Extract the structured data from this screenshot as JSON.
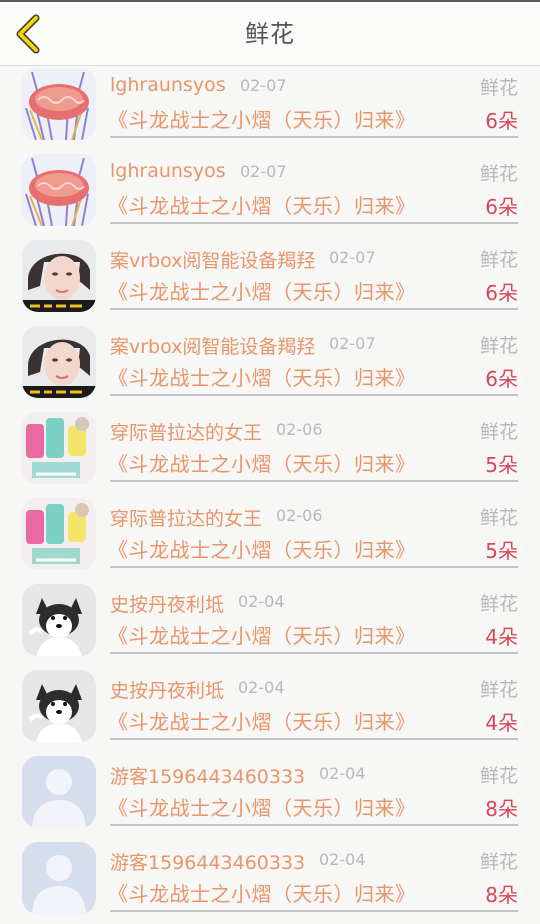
{
  "header": {
    "title": "鲜花"
  },
  "rows": [
    {
      "name": "lghraunsyos",
      "date": "02-07",
      "gift_type": "鲜花",
      "target": "《斗龙战士之小熠（天乐）归来》",
      "count": "6朵",
      "avatar": "cake"
    },
    {
      "name": "lghraunsyos",
      "date": "02-07",
      "gift_type": "鲜花",
      "target": "《斗龙战士之小熠（天乐）归来》",
      "count": "6朵",
      "avatar": "cake"
    },
    {
      "name": "案vrbox阅智能设备羯羟",
      "date": "02-07",
      "gift_type": "鲜花",
      "target": "《斗龙战士之小熠（天乐）归来》",
      "count": "6朵",
      "avatar": "girl"
    },
    {
      "name": "案vrbox阅智能设备羯羟",
      "date": "02-07",
      "gift_type": "鲜花",
      "target": "《斗龙战士之小熠（天乐）归来》",
      "count": "6朵",
      "avatar": "girl"
    },
    {
      "name": "穿际普拉达的女王",
      "date": "02-06",
      "gift_type": "鲜花",
      "target": "《斗龙战士之小熠（天乐）归来》",
      "count": "5朵",
      "avatar": "toys"
    },
    {
      "name": "穿际普拉达的女王",
      "date": "02-06",
      "gift_type": "鲜花",
      "target": "《斗龙战士之小熠（天乐）归来》",
      "count": "5朵",
      "avatar": "toys"
    },
    {
      "name": "史按丹夜利坻",
      "date": "02-04",
      "gift_type": "鲜花",
      "target": "《斗龙战士之小熠（天乐）归来》",
      "count": "4朵",
      "avatar": "dog"
    },
    {
      "name": "史按丹夜利坻",
      "date": "02-04",
      "gift_type": "鲜花",
      "target": "《斗龙战士之小熠（天乐）归来》",
      "count": "4朵",
      "avatar": "dog"
    },
    {
      "name": "游客1596443460333",
      "date": "02-04",
      "gift_type": "鲜花",
      "target": "《斗龙战士之小熠（天乐）归来》",
      "count": "8朵",
      "avatar": "default"
    },
    {
      "name": "游客1596443460333",
      "date": "02-04",
      "gift_type": "鲜花",
      "target": "《斗龙战士之小熠（天乐）归来》",
      "count": "8朵",
      "avatar": "default"
    }
  ],
  "colors": {
    "accent": "#e8956a",
    "count": "#d7465b",
    "muted": "#b8b8b8",
    "back_icon": "#f2d600"
  },
  "icons": {
    "back": "back-arrow-icon"
  }
}
